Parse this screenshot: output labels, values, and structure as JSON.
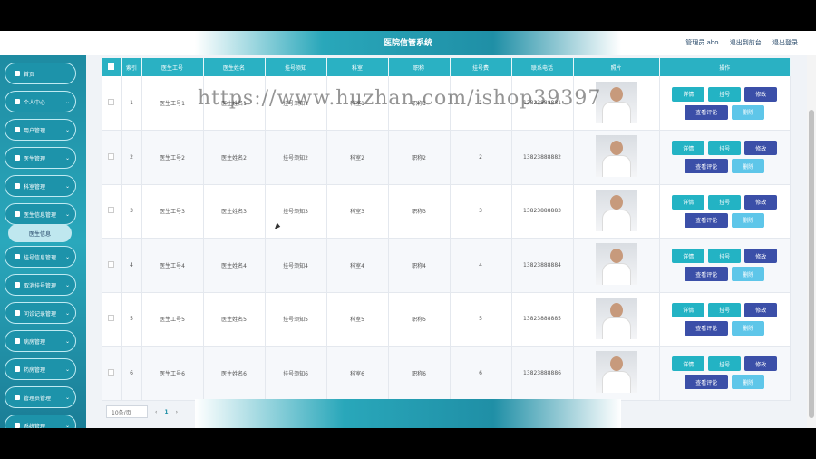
{
  "header": {
    "title": "医院信管系统",
    "admin": "管理员 abo",
    "frontend": "退出到前台",
    "logout": "退出登录"
  },
  "sidebar": {
    "items": [
      {
        "label": "首页"
      },
      {
        "label": "个人中心"
      },
      {
        "label": "用户管理"
      },
      {
        "label": "医生管理"
      },
      {
        "label": "科室管理"
      },
      {
        "label": "医生信息管理"
      },
      {
        "label": "挂号信息管理"
      },
      {
        "label": "取消挂号管理"
      },
      {
        "label": "问诊记录管理"
      },
      {
        "label": "病房管理"
      },
      {
        "label": "药房管理"
      },
      {
        "label": "管理员管理"
      },
      {
        "label": "系统管理"
      }
    ],
    "sub_item": "医生信息"
  },
  "table": {
    "headers": [
      "索引",
      "医生工号",
      "医生姓名",
      "挂号须知",
      "科室",
      "职称",
      "挂号费",
      "联系电话",
      "照片",
      "操作"
    ],
    "rows": [
      {
        "index": "1",
        "work_no": "医生工号1",
        "name": "医生姓名1",
        "notice": "挂号须知1",
        "dept": "科室1",
        "title": "职称1",
        "fee": "1",
        "phone": "13823888881"
      },
      {
        "index": "2",
        "work_no": "医生工号2",
        "name": "医生姓名2",
        "notice": "挂号须知2",
        "dept": "科室2",
        "title": "职称2",
        "fee": "2",
        "phone": "13823888882"
      },
      {
        "index": "3",
        "work_no": "医生工号3",
        "name": "医生姓名3",
        "notice": "挂号须知3",
        "dept": "科室3",
        "title": "职称3",
        "fee": "3",
        "phone": "13823888883"
      },
      {
        "index": "4",
        "work_no": "医生工号4",
        "name": "医生姓名4",
        "notice": "挂号须知4",
        "dept": "科室4",
        "title": "职称4",
        "fee": "4",
        "phone": "13823888884"
      },
      {
        "index": "5",
        "work_no": "医生工号5",
        "name": "医生姓名5",
        "notice": "挂号须知5",
        "dept": "科室5",
        "title": "职称5",
        "fee": "5",
        "phone": "13823888885"
      },
      {
        "index": "6",
        "work_no": "医生工号6",
        "name": "医生姓名6",
        "notice": "挂号须知6",
        "dept": "科室6",
        "title": "职称6",
        "fee": "6",
        "phone": "13823888886"
      }
    ],
    "actions": {
      "detail": "详情",
      "register": "挂号",
      "edit": "修改",
      "review": "查看评论",
      "delete": "删除"
    }
  },
  "pager": {
    "page_size": "10条/页",
    "current_page": "1"
  },
  "watermark": "https://www.huzhan.com/ishop39397",
  "colors": {
    "primary": "#2ab1c3",
    "dark": "#3b4fa8",
    "light": "#5ec6e9"
  }
}
